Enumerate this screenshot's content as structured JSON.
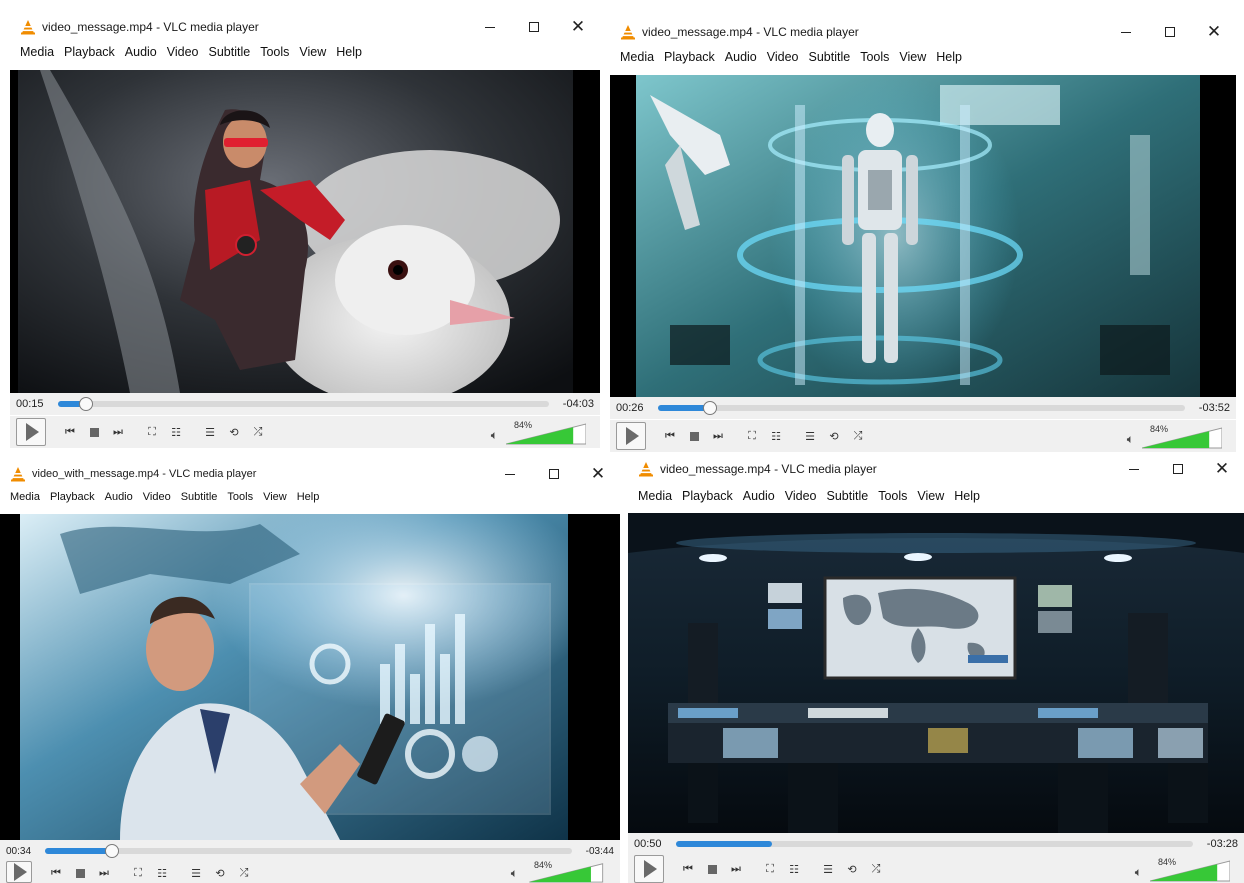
{
  "windows": [
    {
      "title": "video_message.mp4 - VLC media player",
      "menu": [
        "Media",
        "Playback",
        "Audio",
        "Video",
        "Subtitle",
        "Tools",
        "View",
        "Help"
      ],
      "elapsed": "00:15",
      "remaining": "-04:03",
      "progress": 0.058,
      "volume_label": "84%",
      "volume": 0.84,
      "scene": "hero-with-dove"
    },
    {
      "title": "video_message.mp4 - VLC media player",
      "menu": [
        "Media",
        "Playback",
        "Audio",
        "Video",
        "Subtitle",
        "Tools",
        "View",
        "Help"
      ],
      "elapsed": "00:26",
      "remaining": "-03:52",
      "progress": 0.1,
      "volume_label": "84%",
      "volume": 0.84,
      "scene": "robot-in-lab"
    },
    {
      "title": "video_with_message.mp4 - VLC media player",
      "menu": [
        "Media",
        "Playback",
        "Audio",
        "Video",
        "Subtitle",
        "Tools",
        "View",
        "Help"
      ],
      "elapsed": "00:34",
      "remaining": "-03:44",
      "progress": 0.127,
      "volume_label": "84%",
      "volume": 0.84,
      "scene": "man-with-holographic-data"
    },
    {
      "title": "video_message.mp4 - VLC media player",
      "menu": [
        "Media",
        "Playback",
        "Audio",
        "Video",
        "Subtitle",
        "Tools",
        "View",
        "Help"
      ],
      "elapsed": "00:50",
      "remaining": "-03:28",
      "progress": 0.186,
      "volume_label": "84%",
      "volume": 0.84,
      "scene": "control-room-world-map"
    }
  ],
  "icons": {
    "app": "vlc-cone-icon",
    "play": "play-icon",
    "prev": "previous-icon",
    "stop": "stop-icon",
    "next": "next-icon",
    "fullscreen": "fullscreen-icon",
    "extended": "extended-settings-icon",
    "playlist": "playlist-icon",
    "loop": "loop-icon",
    "shuffle": "shuffle-icon",
    "speaker": "speaker-icon"
  },
  "colors": {
    "seek_fill": "#2e88d9",
    "volume_fill": "#37c837",
    "cone": "#f08c00"
  }
}
